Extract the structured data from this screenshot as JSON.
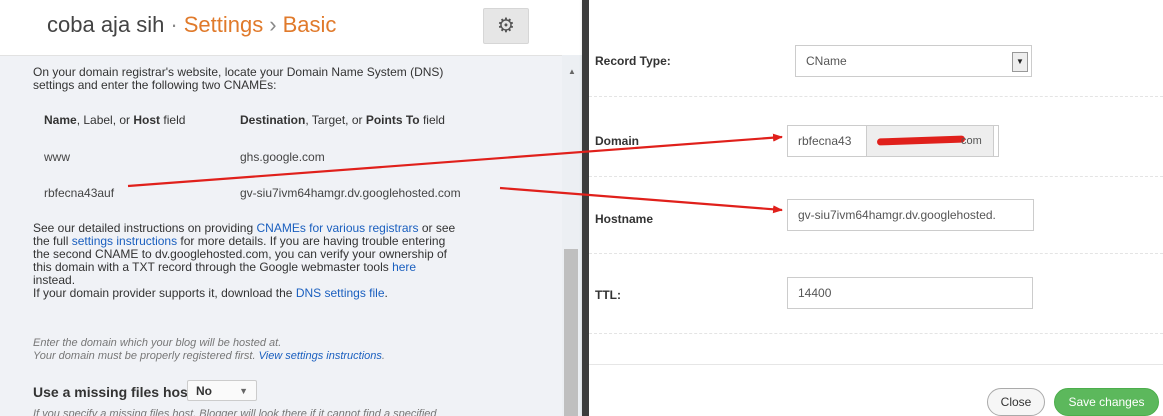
{
  "header": {
    "blog_name": "coba aja sih",
    "separator": "·",
    "section": "Settings",
    "chevron": "›",
    "subsection": "Basic",
    "icon": "gear-icon"
  },
  "instructions": {
    "intro_line1": "On your domain registrar's website, locate your Domain Name System (DNS)",
    "intro_line2": "settings and enter the following two CNAMEs:",
    "col1_a": "Name",
    "col1_b": ", Label",
    "col1_c": ", or ",
    "col1_d": "Host",
    "col1_e": " field",
    "col2_a": "Destination",
    "col2_b": ", Target",
    "col2_c": ", or ",
    "col2_d": "Points To",
    "col2_e": " field",
    "rows": [
      {
        "name": "www",
        "destination": "ghs.google.com"
      },
      {
        "name": "rbfecna43auf",
        "destination": "gv-siu7ivm64hamgr.dv.googlehosted.com"
      }
    ],
    "detail_1": "See our detailed instructions on providing ",
    "link_cnames": "CNAMEs for various registrars",
    "detail_2": " or see",
    "detail_3": "the full ",
    "link_settings": "settings instructions",
    "detail_4": " for more details. If you are having trouble entering",
    "detail_5": "the second CNAME to dv.googlehosted.com, you can verify your ownership of",
    "detail_6": "this domain with a TXT record through the Google webmaster tools ",
    "link_here": "here",
    "detail_7": "instead.",
    "download_1": "If your domain provider supports it, download the ",
    "link_dns": "DNS settings file",
    "download_2": ".",
    "hint_1": "Enter the domain which your blog will be hosted at.",
    "hint_2": "Your domain must be properly registered first. ",
    "hint_link": "View settings instructions",
    "hint_end": ".",
    "missing_label": "Use a missing files host?",
    "missing_value": "No",
    "missing_hint": "If you specify a missing files host, Blogger will look there if it cannot find a specified"
  },
  "dns_form": {
    "record_type_label": "Record Type:",
    "record_type_value": "CName",
    "domain_label": "Domain",
    "domain_value": "rbfecna43",
    "domain_suffix": "com",
    "hostname_label": "Hostname",
    "hostname_value": "gv-siu7ivm64hamgr.dv.googlehosted.",
    "ttl_label": "TTL:",
    "ttl_value": "14400",
    "close_label": "Close",
    "save_label": "Save changes"
  },
  "colors": {
    "accent_orange": "#e07a2b",
    "link_blue": "#1a5fbf",
    "save_green": "#5cb85c",
    "arrow_red": "#e0201b"
  }
}
